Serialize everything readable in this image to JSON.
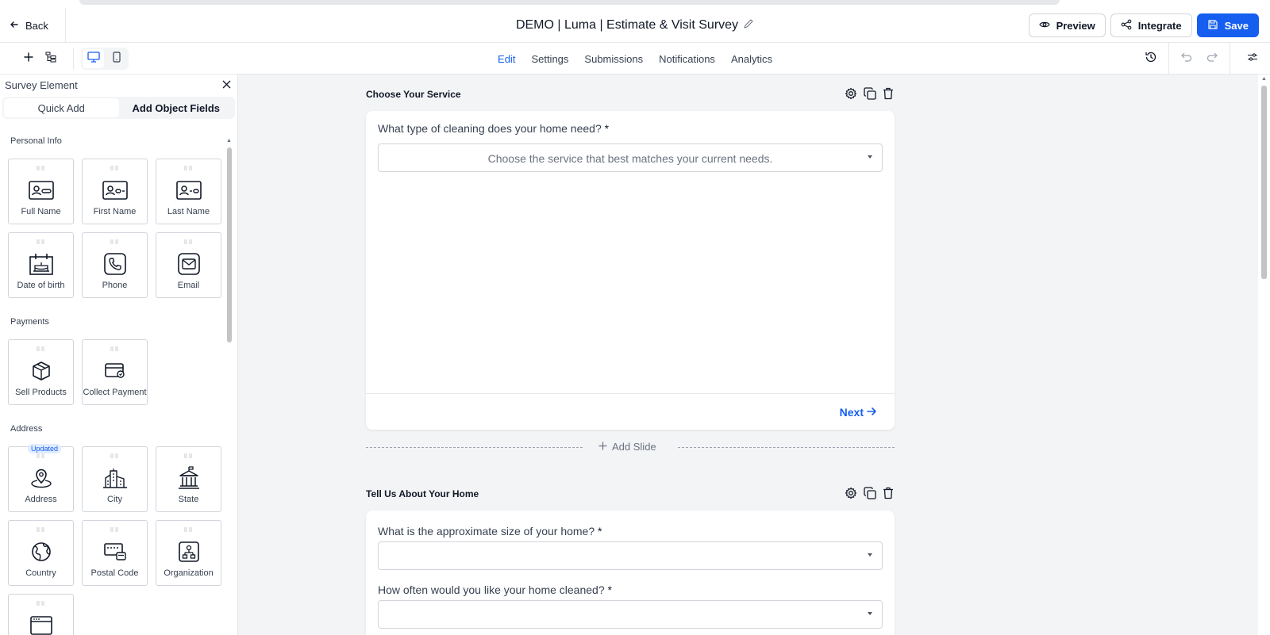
{
  "header": {
    "back_label": "Back",
    "title": "DEMO | Luma | Estimate & Visit Survey",
    "preview_label": "Preview",
    "integrate_label": "Integrate",
    "save_label": "Save"
  },
  "nav": {
    "tabs": [
      "Edit",
      "Settings",
      "Submissions",
      "Notifications",
      "Analytics"
    ],
    "active": "Edit"
  },
  "sidebar": {
    "title": "Survey Element",
    "tabs": [
      "Quick Add",
      "Add Object Fields"
    ],
    "active_tab": "Quick Add",
    "sections": {
      "personal": "Personal Info",
      "payments": "Payments",
      "address": "Address"
    },
    "elements": {
      "full_name": "Full Name",
      "first_name": "First Name",
      "last_name": "Last Name",
      "dob": "Date of birth",
      "phone": "Phone",
      "email": "Email",
      "sell_products": "Sell Products",
      "collect_payment": "Collect Payment",
      "address": "Address",
      "city": "City",
      "state": "State",
      "country": "Country",
      "postal_code": "Postal Code",
      "organization": "Organization"
    },
    "address_badge": "Updated"
  },
  "slides": [
    {
      "title": "Choose Your Service",
      "question": "What type of cleaning does your home need?",
      "required_mark": "*",
      "placeholder": "Choose the service that best matches your current needs.",
      "next_label": "Next"
    },
    {
      "title": "Tell Us About Your Home",
      "questions": [
        {
          "label": "What is the approximate size of your home?",
          "required_mark": "*"
        },
        {
          "label": "How often would you like your home cleaned?",
          "required_mark": "*"
        }
      ]
    }
  ],
  "add_slide_label": "Add Slide",
  "colors": {
    "accent": "#155eef",
    "canvas_bg": "#f3f4f6",
    "border": "#d1d5db"
  }
}
